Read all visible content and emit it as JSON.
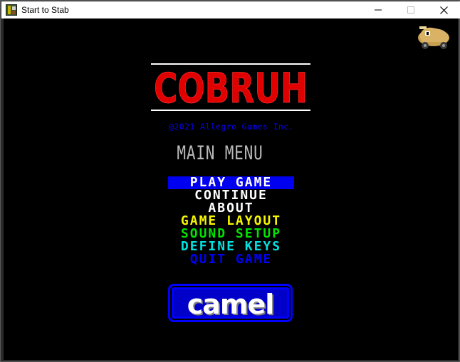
{
  "window": {
    "title": "Start to Stab"
  },
  "game": {
    "logo_text": "COBRUH",
    "copyright": "@2021 Allegro Games Inc.",
    "menu_heading": "MAIN MENU",
    "menu": [
      {
        "label": "PLAY GAME",
        "color": "#ffffff",
        "selected": true
      },
      {
        "label": "CONTINUE",
        "color": "#ffffff",
        "selected": false
      },
      {
        "label": "ABOUT",
        "color": "#ffffff",
        "selected": false
      },
      {
        "label": "GAME LAYOUT",
        "color": "#f6f600",
        "selected": false
      },
      {
        "label": "SOUND SETUP",
        "color": "#00e400",
        "selected": false
      },
      {
        "label": "DEFINE KEYS",
        "color": "#00e2e2",
        "selected": false
      },
      {
        "label": "QUIT GAME",
        "color": "#0000f6",
        "selected": false
      }
    ],
    "badge_text": "camel",
    "colors": {
      "logo_red": "#e10000",
      "copyright_blue": "#0a00f0",
      "selection_blue": "#0000f0",
      "badge_blue": "#0000ff"
    }
  },
  "icons": {
    "app": "game-app-icon",
    "mascot": "camel-mascot-icon"
  }
}
